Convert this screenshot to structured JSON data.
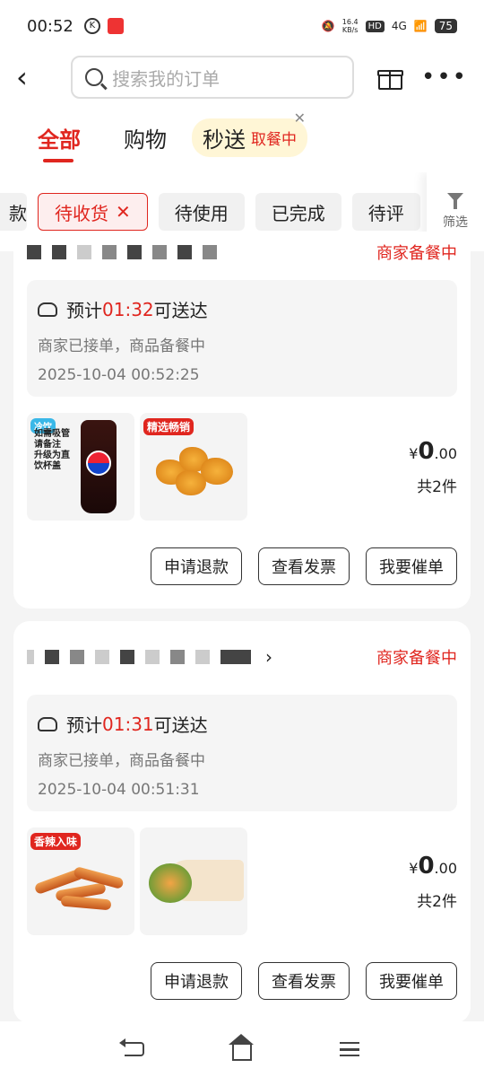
{
  "status_bar": {
    "time": "00:52",
    "speed_top": "16.4",
    "speed_unit": "KB/s",
    "hd": "HD",
    "net": "4G",
    "battery": "75"
  },
  "header": {
    "search_placeholder": "搜索我的订单"
  },
  "tabs": {
    "all": "全部",
    "shopping": "购物",
    "flash": "秒送",
    "flash_sub": "取餐中"
  },
  "filters": {
    "cut_left": "款",
    "items": [
      "待收货",
      "待使用",
      "已完成",
      "待评"
    ],
    "filter_label": "筛选"
  },
  "orders": [
    {
      "status": "商家备餐中",
      "eta_prefix": "预计",
      "eta_time": "01:32",
      "eta_suffix": "可送达",
      "merchant_note": "商家已接单，商品备餐中",
      "datetime": "2025-10-04  00:52:25",
      "thumb1_text": "如需吸管请备注 升级为直饮杯盖",
      "thumb1_tag": "冷饮",
      "thumb2_tag": "精选畅销",
      "currency": "¥",
      "price_int": "0",
      "price_dec": ".00",
      "count": "共2件",
      "buttons": [
        "申请退款",
        "查看发票",
        "我要催单"
      ]
    },
    {
      "status": "商家备餐中",
      "eta_prefix": "预计",
      "eta_time": "01:31",
      "eta_suffix": "可送达",
      "merchant_note": "商家已接单，商品备餐中",
      "datetime": "2025-10-04  00:51:31",
      "thumb1_tag": "香辣入味",
      "currency": "¥",
      "price_int": "0",
      "price_dec": ".00",
      "count": "共2件",
      "buttons": [
        "申请退款",
        "查看发票",
        "我要催单"
      ]
    }
  ],
  "colors": {
    "accent": "#e0261f",
    "bg": "#f4f4f4"
  }
}
